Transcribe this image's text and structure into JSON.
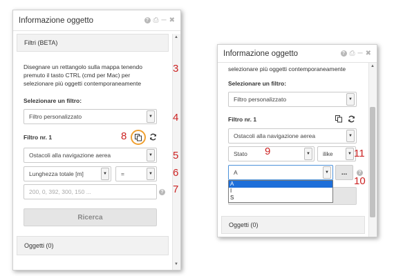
{
  "left": {
    "title": "Informazione oggetto",
    "filters_section": "Filtri (BETA)",
    "instructions": [
      "Disegnare un rettangolo sulla mappa tenendo",
      "premuto il tasto CTRL (cmd per Mac) per",
      "selezionare più oggetti contemporaneamente"
    ],
    "select_filter_label": "Selezionare un filtro:",
    "filter_type": "Filtro personalizzato",
    "filter_nr": "Filtro nr. 1",
    "layer": "Ostacoli alla navigazione aerea",
    "attribute": "Lunghezza totale [m]",
    "operator": "=",
    "value_placeholder": "200, 0, 392, 300, 150 ...",
    "search_button": "Ricerca",
    "objects": "Oggetti (0)"
  },
  "right": {
    "title": "Informazione oggetto",
    "instructions_tail": "selezionare più oggetti contemporaneamente",
    "select_filter_label": "Selezionare un filtro:",
    "filter_type": "Filtro personalizzato",
    "filter_nr": "Filtro nr. 1",
    "layer": "Ostacoli alla navigazione aerea",
    "attribute": "Stato",
    "operator": "ilike",
    "value": "A",
    "more_button": "...",
    "options": [
      "A",
      "I",
      "S"
    ],
    "objects": "Oggetti (0)"
  },
  "callouts": {
    "n3": "3",
    "n4": "4",
    "n5": "5",
    "n6": "6",
    "n7": "7",
    "n8": "8",
    "n9": "9",
    "n10": "10",
    "n11": "11"
  },
  "colors": {
    "callout": "#cc2222",
    "highlight_ring": "#f0a030",
    "selected_option": "#1e6fd9"
  }
}
